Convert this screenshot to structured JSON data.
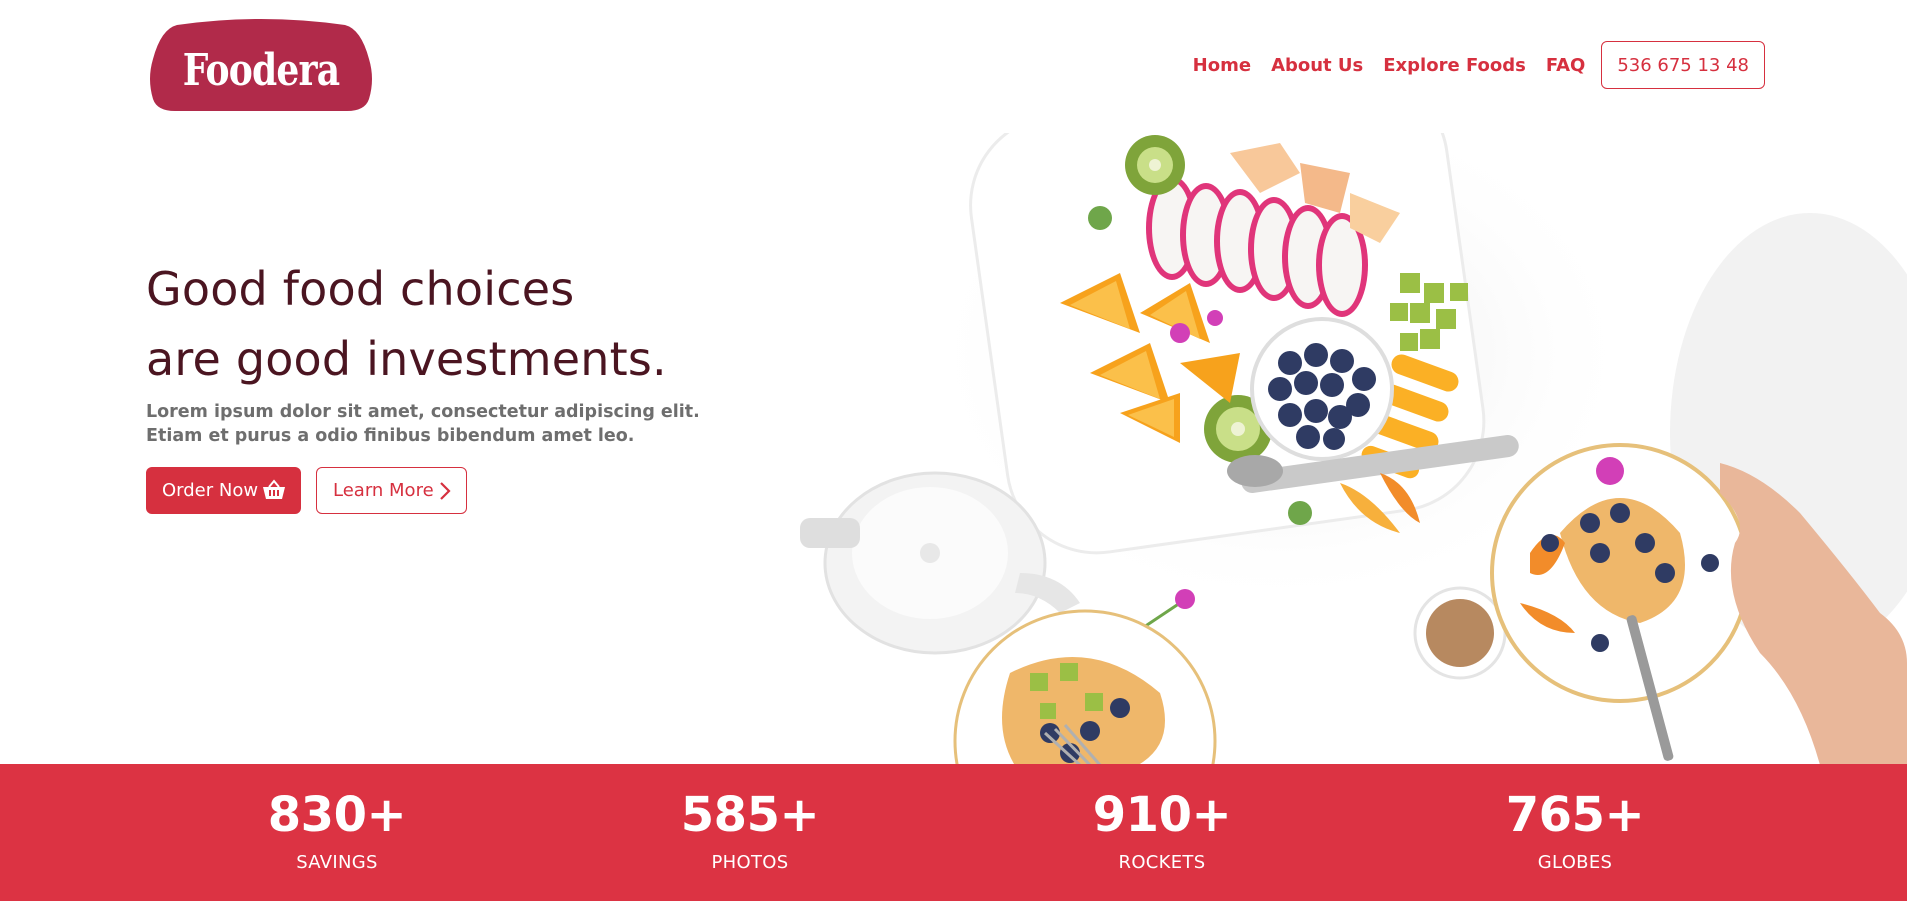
{
  "brand": {
    "name": "Foodera",
    "color": "#b12a4a"
  },
  "nav": {
    "items": [
      {
        "label": "Home"
      },
      {
        "label": "About Us"
      },
      {
        "label": "Explore Foods"
      },
      {
        "label": "FAQ"
      }
    ],
    "phone": "536 675 13 48"
  },
  "hero": {
    "title_line1": "Good food choices",
    "title_line2": "are good investments.",
    "subtitle_line1": "Lorem ipsum dolor sit amet, consectetur adipiscing elit.",
    "subtitle_line2": "Etiam et purus a odio finibus bibendum amet leo.",
    "order_label": "Order Now",
    "order_icon": "basket-icon",
    "learn_label": "Learn More",
    "learn_icon": "chevron-right-icon",
    "image": "food-platter-photo"
  },
  "stats": [
    {
      "value": "830+",
      "label": "SAVINGS"
    },
    {
      "value": "585+",
      "label": "PHOTOS"
    },
    {
      "value": "910+",
      "label": "ROCKETS"
    },
    {
      "value": "765+",
      "label": "GLOBES"
    }
  ],
  "colors": {
    "accent": "#dc3343",
    "heading": "#4b1521",
    "body": "#6e6e6e",
    "white": "#ffffff"
  }
}
